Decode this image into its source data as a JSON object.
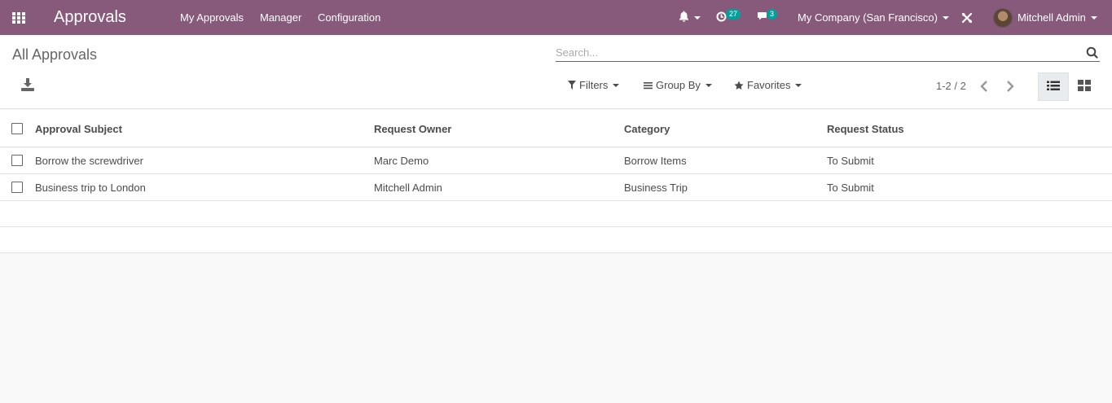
{
  "navbar": {
    "app_title": "Approvals",
    "menu": [
      "My Approvals",
      "Manager",
      "Configuration"
    ],
    "activity_count": "27",
    "messages_count": "3",
    "company": "My Company (San Francisco)",
    "user": "Mitchell Admin",
    "color": "#875a7b",
    "badge_color": "#00a09d"
  },
  "control_panel": {
    "breadcrumb": "All Approvals",
    "search_placeholder": "Search...",
    "filters_label": "Filters",
    "groupby_label": "Group By",
    "favorites_label": "Favorites",
    "pager": "1-2 / 2"
  },
  "table": {
    "columns": [
      "Approval Subject",
      "Request Owner",
      "Category",
      "Request Status"
    ],
    "rows": [
      [
        "Borrow the screwdriver",
        "Marc Demo",
        "Borrow Items",
        "To Submit"
      ],
      [
        "Business trip to London",
        "Mitchell Admin",
        "Business Trip",
        "To Submit"
      ]
    ]
  },
  "icons": {
    "apps": "apps-grid-icon",
    "bell": "bell-icon",
    "activity": "clock-icon",
    "messages": "chat-icon",
    "debug": "debug-icon",
    "download": "download-icon",
    "search": "search-icon",
    "filter": "filter-icon",
    "groupby": "list-icon",
    "favorite": "star-icon",
    "list_view": "list-view-icon",
    "kanban_view": "kanban-view-icon"
  }
}
